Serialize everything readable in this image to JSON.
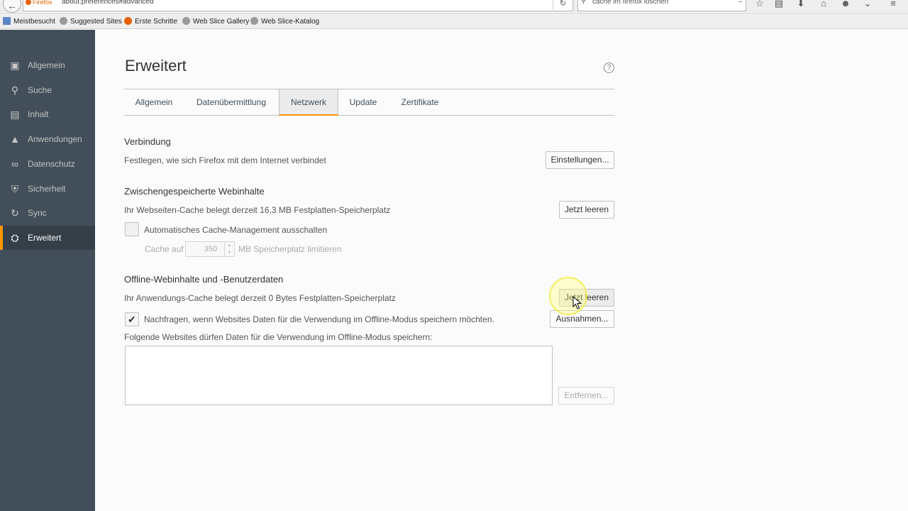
{
  "browser": {
    "identity_label": "Firefox",
    "url": "about:preferences#advanced",
    "search_text": "cache im firefox löschen",
    "bookmarks": [
      {
        "label": "Meistbesucht",
        "icon": "bookmarks-folder-icon"
      },
      {
        "label": "Suggested Sites",
        "icon": "suggested-sites-icon"
      },
      {
        "label": "Erste Schritte",
        "icon": "firefox-icon"
      },
      {
        "label": "Web Slice Gallery",
        "icon": "web-slice-icon"
      },
      {
        "label": "Web Slice-Katalog",
        "icon": "web-slice-icon"
      }
    ],
    "toolbar_icons": [
      "star-icon",
      "reading-list-icon",
      "download-icon",
      "home-icon",
      "chat-icon",
      "pocket-icon",
      "menu-icon"
    ]
  },
  "sidebar": {
    "items": [
      {
        "label": "Allgemein",
        "icon": "general-icon",
        "glyph": "▣"
      },
      {
        "label": "Suche",
        "icon": "search-icon",
        "glyph": "⚲"
      },
      {
        "label": "Inhalt",
        "icon": "content-icon",
        "glyph": "▤"
      },
      {
        "label": "Anwendungen",
        "icon": "applications-icon",
        "glyph": "▲"
      },
      {
        "label": "Datenschutz",
        "icon": "privacy-mask-icon",
        "glyph": "∞"
      },
      {
        "label": "Sicherheit",
        "icon": "security-icon",
        "glyph": "⛨"
      },
      {
        "label": "Sync",
        "icon": "sync-icon",
        "glyph": "↻"
      },
      {
        "label": "Erweitert",
        "icon": "advanced-wizard-hat-icon",
        "glyph": "⛭"
      }
    ],
    "selected": "Erweitert"
  },
  "main": {
    "title": "Erweitert",
    "tabs": [
      {
        "label": "Allgemein"
      },
      {
        "label": "Datenübermittlung"
      },
      {
        "label": "Netzwerk"
      },
      {
        "label": "Update"
      },
      {
        "label": "Zertifikate"
      }
    ],
    "selected_tab": "Netzwerk",
    "connection": {
      "caption": "Verbindung",
      "description": "Festlegen, wie sich Firefox mit dem Internet verbindet",
      "settings_button": "Einstellungen..."
    },
    "cache": {
      "caption": "Zwischengespeicherte Webinhalte",
      "description": "Ihr Webseiten-Cache belegt derzeit 16,3 MB Festplatten-Speicherplatz",
      "clear_button": "Jetzt leeren",
      "override_label": "Automatisches Cache-Management ausschalten",
      "override_checked": false,
      "limit_prefix": "Cache auf",
      "limit_value": "350",
      "limit_suffix": "MB Speicherplatz limitieren"
    },
    "offline": {
      "caption": "Offline-Webinhalte und -Benutzerdaten",
      "description": "Ihr Anwendungs-Cache belegt derzeit 0 Bytes Festplatten-Speicherplatz",
      "clear_button": "Jetzt leeren",
      "notify_label": "Nachfragen, wenn Websites Daten für die Verwendung im Offline-Modus speichern möchten.",
      "notify_checked": true,
      "exceptions_button": "Ausnahmen...",
      "list_label": "Folgende Websites dürfen Daten für die Verwendung im Offline-Modus speichern:",
      "remove_button": "Entfernen..."
    }
  },
  "colors": {
    "sidebar_bg": "#424f5a",
    "sidebar_selected_bg": "#343f48",
    "accent": "#ff9500",
    "content_bg": "#fbfbfb"
  }
}
